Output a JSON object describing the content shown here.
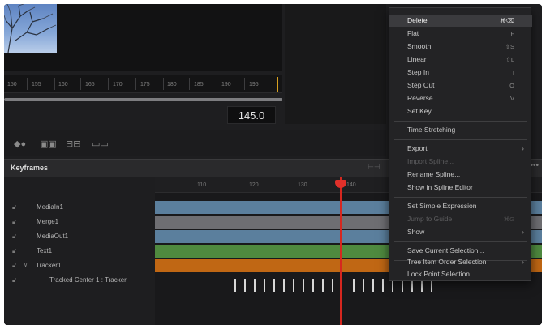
{
  "viewer": {
    "ruler_ticks": [
      "150",
      "155",
      "160",
      "165",
      "170",
      "175",
      "180",
      "185",
      "190",
      "195"
    ],
    "timecode": "145.0"
  },
  "keyframes": {
    "title": "Keyframes",
    "menu_glyph": "•••",
    "tracks": [
      "MediaIn1",
      "Merge1",
      "MediaOut1",
      "Text1",
      "Tracker1",
      "Tracked Center 1 : Tracker"
    ],
    "timeline_ticks": [
      "110",
      "120",
      "130",
      "140"
    ]
  },
  "context_menu": {
    "items": [
      {
        "label": "Delete",
        "shortcut": "⌘⌫",
        "highlighted": true
      },
      {
        "label": "Flat",
        "shortcut": "F"
      },
      {
        "label": "Smooth",
        "shortcut": "⇧S"
      },
      {
        "label": "Linear",
        "shortcut": "⇧L"
      },
      {
        "label": "Step In",
        "shortcut": "I"
      },
      {
        "label": "Step Out",
        "shortcut": "O"
      },
      {
        "label": "Reverse",
        "shortcut": "V"
      },
      {
        "label": "Set Key",
        "shortcut": ""
      },
      {
        "label": "Time Stretching",
        "shortcut": ""
      },
      {
        "label": "Export",
        "submenu": true
      },
      {
        "label": "Import Spline...",
        "disabled": true
      },
      {
        "label": "Rename Spline...",
        "shortcut": ""
      },
      {
        "label": "Show in Spline Editor",
        "shortcut": ""
      },
      {
        "label": "Set Simple Expression",
        "shortcut": ""
      },
      {
        "label": "Jump to Guide",
        "shortcut": "⌘G",
        "disabled": true
      },
      {
        "label": "Show",
        "submenu": true
      },
      {
        "label": "Save Current Selection...",
        "shortcut": ""
      },
      {
        "label": "Tree Item Order Selection",
        "submenu": true
      },
      {
        "label": "Lock Point Selection",
        "shortcut": ""
      }
    ]
  },
  "colors": {
    "background": "#1e1e20",
    "playhead": "#d6271f",
    "track_blue": "#5b7f9d",
    "track_grey": "#6e6e72",
    "track_green": "#4f8a3f",
    "track_orange": "#c06714"
  }
}
